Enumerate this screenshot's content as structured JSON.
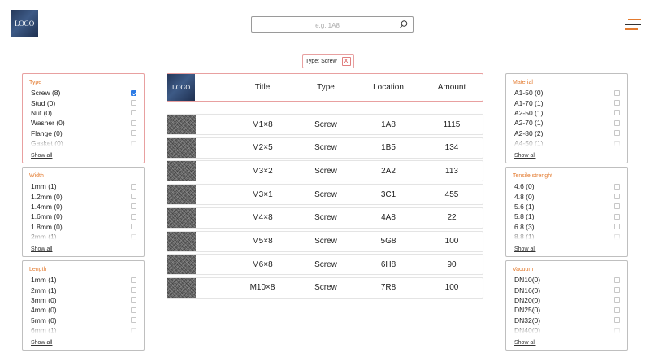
{
  "header": {
    "logo_text": "LOGO",
    "search_placeholder": "e.g. 1A8"
  },
  "active_filter": {
    "label": "Type: Screw",
    "remove": "X"
  },
  "show_all_label": "Show all",
  "filters_left": [
    {
      "title": "Type",
      "options": [
        {
          "label": "Screw (8)",
          "checked": true
        },
        {
          "label": "Stud (0)",
          "checked": false
        },
        {
          "label": "Nut (0)",
          "checked": false
        },
        {
          "label": "Washer (0)",
          "checked": false
        },
        {
          "label": "Flange (0)",
          "checked": false
        },
        {
          "label": "Gasket (0)",
          "checked": false
        }
      ]
    },
    {
      "title": "Width",
      "options": [
        {
          "label": "1mm (1)",
          "checked": false
        },
        {
          "label": "1.2mm (0)",
          "checked": false
        },
        {
          "label": "1.4mm (0)",
          "checked": false
        },
        {
          "label": "1.6mm (0)",
          "checked": false
        },
        {
          "label": "1.8mm (0)",
          "checked": false
        },
        {
          "label": "2mm (1)",
          "checked": false
        }
      ]
    },
    {
      "title": "Length",
      "options": [
        {
          "label": "1mm (1)",
          "checked": false
        },
        {
          "label": "2mm (1)",
          "checked": false
        },
        {
          "label": "3mm (0)",
          "checked": false
        },
        {
          "label": "4mm (0)",
          "checked": false
        },
        {
          "label": "5mm (0)",
          "checked": false
        },
        {
          "label": "6mm (1)",
          "checked": false
        }
      ]
    }
  ],
  "filters_right": [
    {
      "title": "Material",
      "options": [
        {
          "label": "A1-50 (0)",
          "checked": false
        },
        {
          "label": "A1-70 (1)",
          "checked": false
        },
        {
          "label": "A2-50 (1)",
          "checked": false
        },
        {
          "label": "A2-70 (1)",
          "checked": false
        },
        {
          "label": "A2-80 (2)",
          "checked": false
        },
        {
          "label": "A4-50 (1)",
          "checked": false
        }
      ]
    },
    {
      "title": "Tensile strenght",
      "options": [
        {
          "label": "4.6 (0)",
          "checked": false
        },
        {
          "label": "4.8 (0)",
          "checked": false
        },
        {
          "label": "5.6 (1)",
          "checked": false
        },
        {
          "label": "5.8 (1)",
          "checked": false
        },
        {
          "label": "6.8 (3)",
          "checked": false
        },
        {
          "label": "8.8 (1)",
          "checked": false
        }
      ]
    },
    {
      "title": "Vacuum",
      "options": [
        {
          "label": "DN10(0)",
          "checked": false
        },
        {
          "label": "DN16(0)",
          "checked": false
        },
        {
          "label": "DN20(0)",
          "checked": false
        },
        {
          "label": "DN25(0)",
          "checked": false
        },
        {
          "label": "DN32(0)",
          "checked": false
        },
        {
          "label": "DN40(0)",
          "checked": false
        }
      ]
    }
  ],
  "table": {
    "logo_text": "LOGO",
    "columns": [
      "Title",
      "Type",
      "Location",
      "Amount"
    ],
    "rows": [
      {
        "title": "M1×8",
        "type": "Screw",
        "location": "1A8",
        "amount": "1115"
      },
      {
        "title": "M2×5",
        "type": "Screw",
        "location": "1B5",
        "amount": "134"
      },
      {
        "title": "M3×2",
        "type": "Screw",
        "location": "2A2",
        "amount": "113"
      },
      {
        "title": "M3×1",
        "type": "Screw",
        "location": "3C1",
        "amount": "455"
      },
      {
        "title": "M4×8",
        "type": "Screw",
        "location": "4A8",
        "amount": "22"
      },
      {
        "title": "M5×8",
        "type": "Screw",
        "location": "5G8",
        "amount": "100"
      },
      {
        "title": "M6×8",
        "type": "Screw",
        "location": "6H8",
        "amount": "90"
      },
      {
        "title": "M10×8",
        "type": "Screw",
        "location": "7R8",
        "amount": "100"
      }
    ]
  },
  "colors": {
    "accent": "#e37a2e",
    "active_border": "#e8a0a0",
    "checkbox_checked": "#2c7be5"
  }
}
